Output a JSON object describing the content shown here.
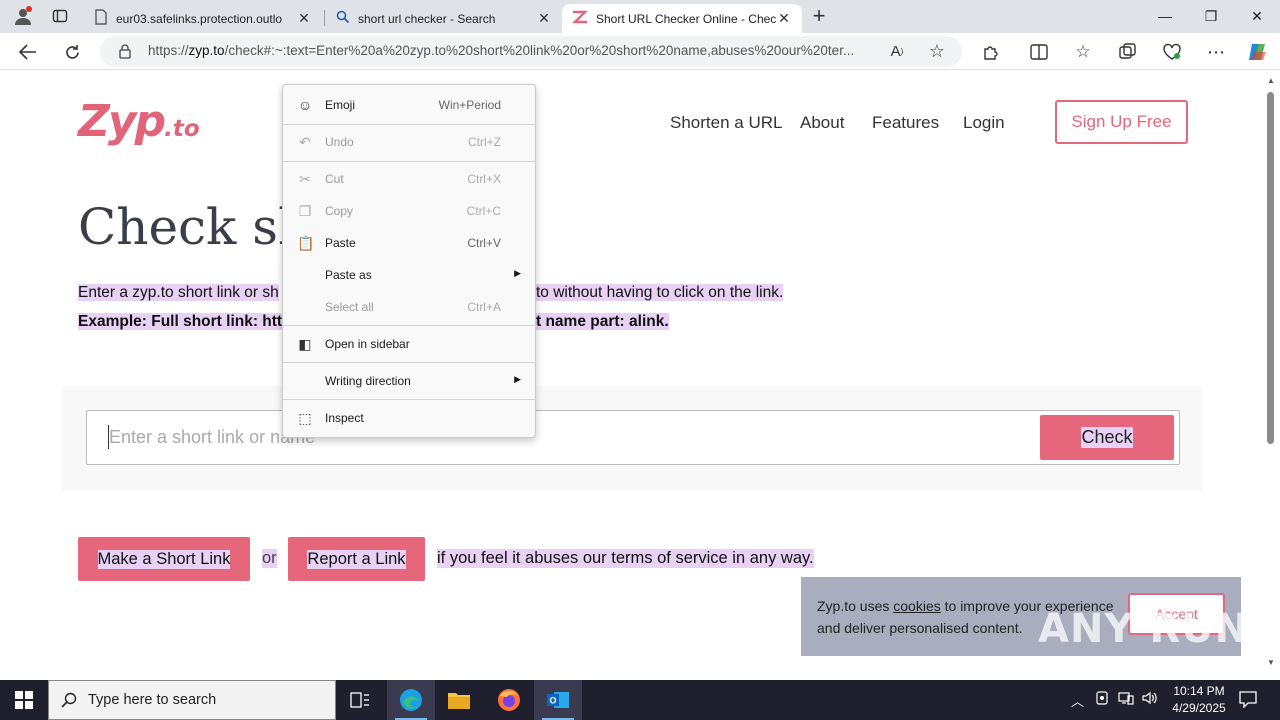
{
  "browser": {
    "tabs": [
      {
        "title": "eur03.safelinks.protection.outlo",
        "icon": "page-icon",
        "active": false
      },
      {
        "title": "short url checker - Search",
        "icon": "search-icon",
        "active": false
      },
      {
        "title": "Short URL Checker Online - Chec",
        "icon": "zyp-favicon",
        "active": true
      }
    ],
    "url_prefix": "https://",
    "url_domain": "zyp.to",
    "url_rest": "/check#:~:text=Enter%20a%20zyp.to%20short%20link%20or%20short%20name,abuses%20our%20ter..."
  },
  "site": {
    "logo_main": "Zyp",
    "logo_suffix": ".to",
    "nav": [
      "Shorten a URL",
      "About",
      "Features",
      "Login"
    ],
    "signup": "Sign Up Free",
    "headline": "Check sh",
    "desc_line1_a": "Enter a zyp.to short link or sh",
    "desc_line1_b": "to without having to click on the link.",
    "desc_line2_a": "Example: Full short link: https",
    "desc_line2_b": "t name part: alink.",
    "input_placeholder": "Enter a short link or name",
    "check_button": "Check",
    "make_link_button": "Make a Short Link",
    "or_text": "or",
    "report_button": "Report a Link",
    "abuse_text": "if you feel it abuses our terms of service in any way."
  },
  "cookie": {
    "text_before": "Zyp.to uses ",
    "link": "cookies",
    "text_after": " to improve your experience and deliver personalised content.",
    "accept": "Accept"
  },
  "watermark": "ANY RUN",
  "context_menu": {
    "items": [
      {
        "label": "Emoji",
        "shortcut": "Win+Period",
        "icon": "emoji-icon",
        "disabled": false
      },
      {
        "label": "Undo",
        "shortcut": "Ctrl+Z",
        "icon": "undo-icon",
        "disabled": true
      },
      {
        "label": "Cut",
        "shortcut": "Ctrl+X",
        "icon": "cut-icon",
        "disabled": true
      },
      {
        "label": "Copy",
        "shortcut": "Ctrl+C",
        "icon": "copy-icon",
        "disabled": true
      },
      {
        "label": "Paste",
        "shortcut": "Ctrl+V",
        "icon": "paste-icon",
        "disabled": false
      },
      {
        "label": "Paste as",
        "shortcut": "",
        "icon": "",
        "disabled": false,
        "submenu": true
      },
      {
        "label": "Select all",
        "shortcut": "Ctrl+A",
        "icon": "",
        "disabled": true
      },
      {
        "label": "Open in sidebar",
        "shortcut": "",
        "icon": "sidebar-icon",
        "disabled": false
      },
      {
        "label": "Writing direction",
        "shortcut": "",
        "icon": "",
        "disabled": false,
        "submenu": true
      },
      {
        "label": "Inspect",
        "shortcut": "",
        "icon": "inspect-icon",
        "disabled": false
      }
    ]
  },
  "taskbar": {
    "search_placeholder": "Type here to search",
    "time": "10:14 PM",
    "date": "4/29/2025"
  }
}
